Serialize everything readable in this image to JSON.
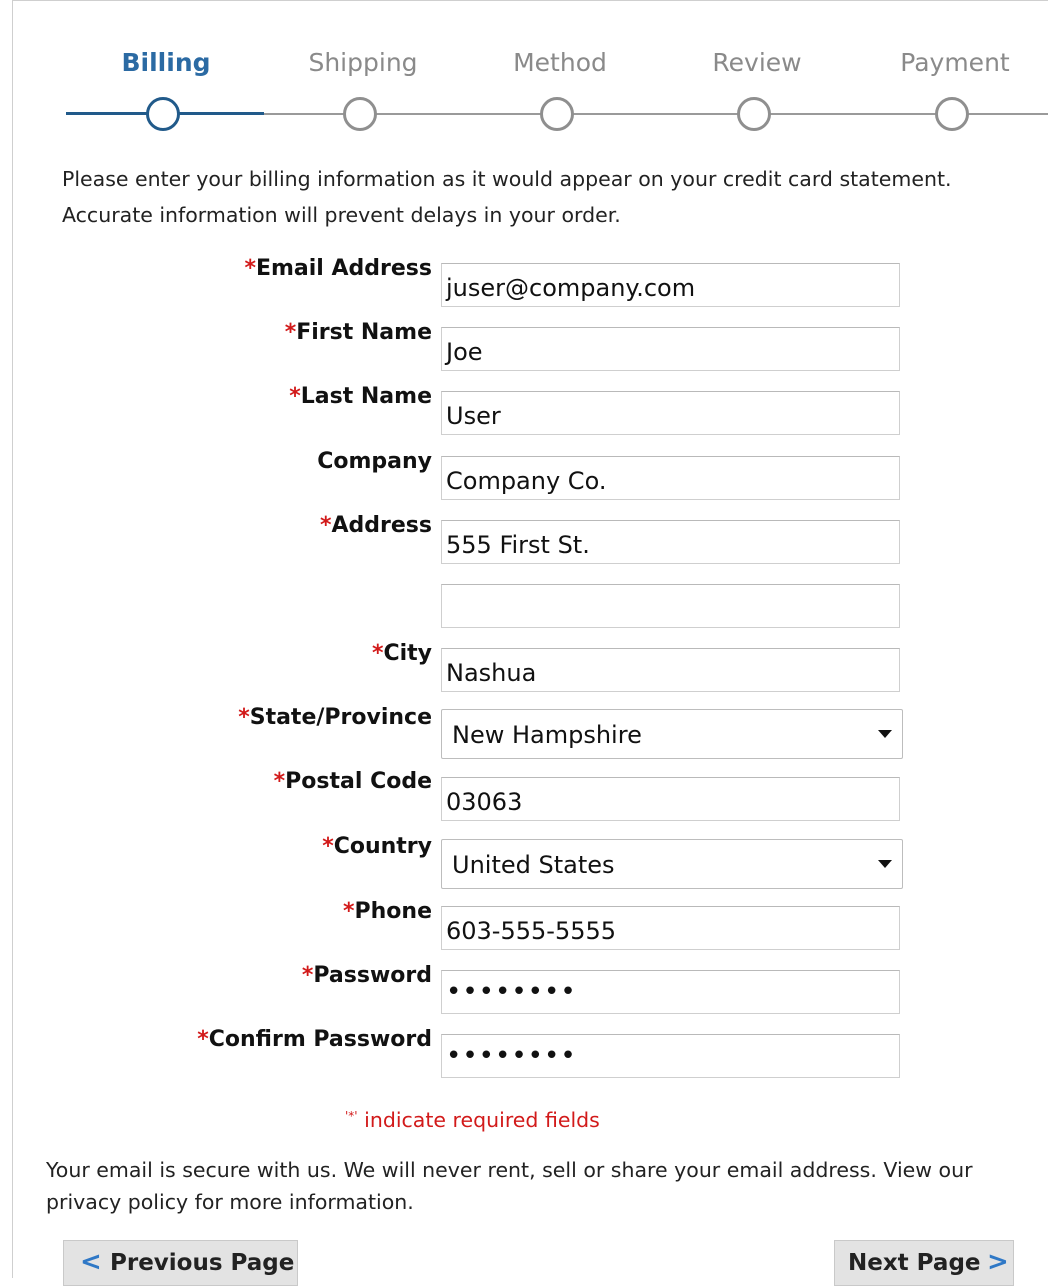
{
  "steps": [
    {
      "label": "Billing",
      "active": true
    },
    {
      "label": "Shipping",
      "active": false
    },
    {
      "label": "Method",
      "active": false
    },
    {
      "label": "Review",
      "active": false
    },
    {
      "label": "Payment",
      "active": false
    }
  ],
  "intro": {
    "line1": "Please enter your billing information as it would appear on your credit card statement.",
    "line2": "Accurate information will prevent delays in your order."
  },
  "form": {
    "required_mark": "*",
    "email": {
      "label": "Email Address",
      "value": "juser@company.com"
    },
    "first_name": {
      "label": "First Name",
      "value": "Joe"
    },
    "last_name": {
      "label": "Last Name",
      "value": "User"
    },
    "company": {
      "label": "Company",
      "value": "Company Co."
    },
    "address": {
      "label": "Address",
      "value": "555 First St.",
      "line2_value": ""
    },
    "city": {
      "label": "City",
      "value": "Nashua"
    },
    "state": {
      "label": "State/Province",
      "value": "New Hampshire"
    },
    "postal_code": {
      "label": "Postal Code",
      "value": "03063"
    },
    "country": {
      "label": "Country",
      "value": "United States"
    },
    "phone": {
      "label": "Phone",
      "value": "603-555-5555"
    },
    "password": {
      "label": "Password",
      "value": "••••••••"
    },
    "confirm_password": {
      "label": "Confirm Password",
      "value": "••••••••"
    }
  },
  "required_note": {
    "mark": "'*'",
    "text": "indicate required fields"
  },
  "privacy_text": {
    "line1": "Your email is secure with us. We will never rent, sell or share your email address. View our",
    "line2": "privacy policy for more information."
  },
  "nav": {
    "previous_label": "Previous Page",
    "next_label": "Next Page",
    "prev_icon": "<",
    "next_icon": ">"
  }
}
